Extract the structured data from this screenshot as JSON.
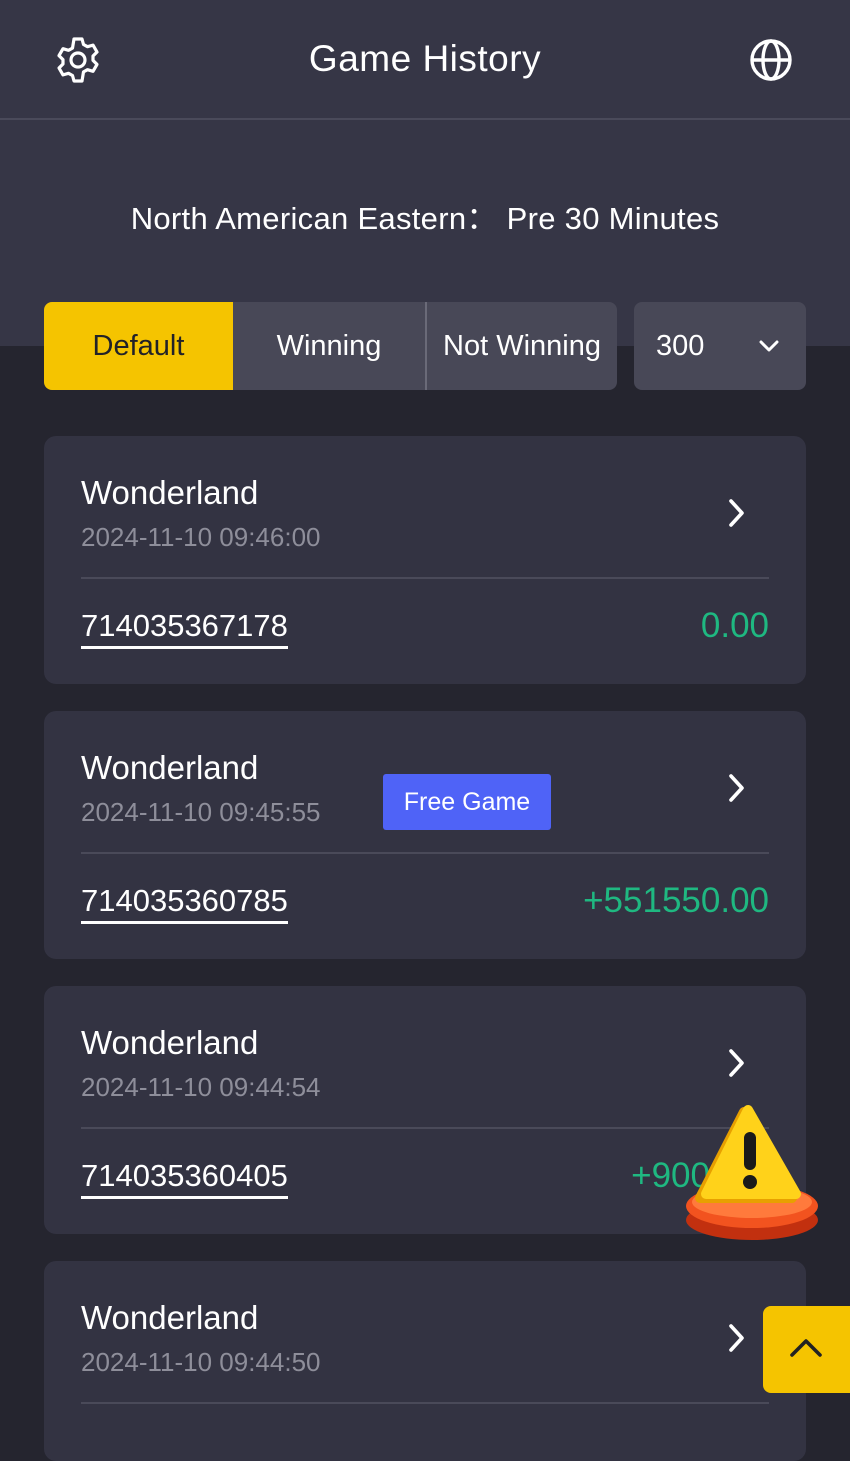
{
  "header": {
    "title": "Game History",
    "settings_icon": "gear-icon",
    "language_icon": "globe-icon"
  },
  "timezone": {
    "text": "North American Eastern： Pre 30 Minutes"
  },
  "filters": {
    "tabs": [
      {
        "label": "Default",
        "active": true
      },
      {
        "label": "Winning",
        "active": false
      },
      {
        "label": "Not Winning",
        "active": false
      }
    ],
    "count_select": {
      "value": "300",
      "icon": "chevron-down-icon"
    }
  },
  "records": [
    {
      "game": "Wonderland",
      "time": "2024-11-10 09:46:00",
      "round_id": "714035367178",
      "amount": "0.00",
      "badge": ""
    },
    {
      "game": "Wonderland",
      "time": "2024-11-10 09:45:55",
      "round_id": "714035360785",
      "amount": "+551550.00",
      "badge": "Free Game"
    },
    {
      "game": "Wonderland",
      "time": "2024-11-10 09:44:54",
      "round_id": "714035360405",
      "amount": "+900",
      "badge": ""
    },
    {
      "game": "Wonderland",
      "time": "2024-11-10 09:44:50",
      "round_id": "",
      "amount": "",
      "badge": ""
    }
  ],
  "overlays": {
    "warning_icon": "warning-icon",
    "scroll_top_icon": "chevron-up-icon"
  },
  "colors": {
    "accent": "#f5c400",
    "win": "#1fb881",
    "badge": "#4f63f7",
    "background": "#25252f",
    "card": "#333342"
  }
}
